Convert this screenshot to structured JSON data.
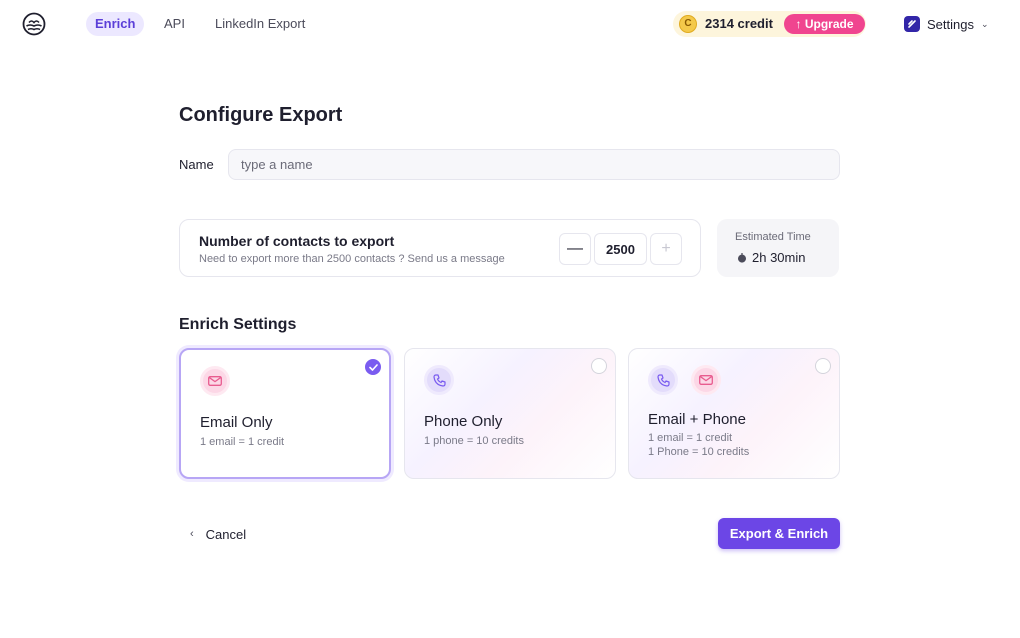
{
  "nav": {
    "tabs": [
      {
        "label": "Enrich",
        "active": true
      },
      {
        "label": "API",
        "active": false
      },
      {
        "label": "LinkedIn Export",
        "active": false
      }
    ],
    "credit_text": "2314 credit",
    "credit_icon": "coin-icon",
    "upgrade_label": "Upgrade",
    "upgrade_icon": "arrow-up-icon",
    "settings_label": "Settings",
    "settings_icon": "app-badge-icon"
  },
  "form": {
    "title": "Configure Export",
    "name_label": "Name",
    "name_placeholder": "type a name",
    "name_value": ""
  },
  "contacts": {
    "title": "Number of contacts to export",
    "subtitle": "Need to export more than 2500 contacts ? Send us a message",
    "minus_label": "—",
    "plus_label": "+",
    "value": "2500"
  },
  "estimate": {
    "label": "Estimated Time",
    "value": "2h 30min",
    "icon": "stopwatch-icon"
  },
  "enrich": {
    "section_title": "Enrich Settings",
    "options": [
      {
        "title": "Email Only",
        "desc": [
          "1 email = 1 credit"
        ],
        "icons": [
          "mail-icon"
        ],
        "selected": true
      },
      {
        "title": "Phone Only",
        "desc": [
          "1 phone = 10 credits"
        ],
        "icons": [
          "phone-icon"
        ],
        "selected": false
      },
      {
        "title": "Email + Phone",
        "desc": [
          "1 email = 1 credit",
          "1 Phone = 10 credits"
        ],
        "icons": [
          "phone-icon",
          "mail-icon"
        ],
        "selected": false
      }
    ]
  },
  "footer": {
    "cancel_label": "Cancel",
    "submit_label": "Export & Enrich"
  },
  "colors": {
    "accent": "#6c46e6",
    "upgrade": "#f0458f",
    "credit_bg": "#fdf5dc"
  }
}
